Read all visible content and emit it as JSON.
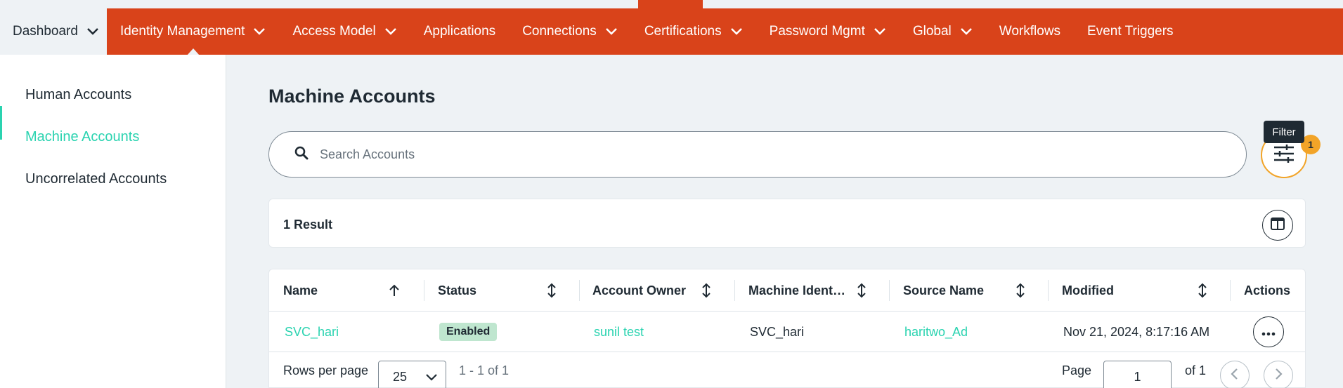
{
  "nav": {
    "items": [
      {
        "label": "Dashboard",
        "dropdown": true
      },
      {
        "label": "Identity Management",
        "dropdown": true,
        "active": true
      },
      {
        "label": "Access Model",
        "dropdown": true
      },
      {
        "label": "Applications",
        "dropdown": false
      },
      {
        "label": "Connections",
        "dropdown": true
      },
      {
        "label": "Certifications",
        "dropdown": true
      },
      {
        "label": "Password Mgmt",
        "dropdown": true
      },
      {
        "label": "Global",
        "dropdown": true
      },
      {
        "label": "Workflows",
        "dropdown": false
      },
      {
        "label": "Event Triggers",
        "dropdown": false
      }
    ],
    "bg_color": "#d9431a"
  },
  "sidebar": {
    "items": [
      {
        "label": "Human Accounts"
      },
      {
        "label": "Machine Accounts",
        "active": true
      },
      {
        "label": "Uncorrelated Accounts"
      }
    ],
    "accent_color": "#2ad3b0"
  },
  "main": {
    "title": "Machine Accounts",
    "search": {
      "placeholder": "Search Accounts",
      "value": "",
      "icon": "search-icon"
    },
    "filter": {
      "tooltip": "Filter",
      "badge_count": "1",
      "icon": "filter-sliders-icon"
    },
    "result_count": "1 Result",
    "table": {
      "columns": [
        "Name",
        "Status",
        "Account Owner",
        "Machine Ident…",
        "Source Name",
        "Modified",
        "Actions"
      ],
      "rows": [
        {
          "name": "SVC_hari",
          "status": "Enabled",
          "account_owner": "sunil test",
          "machine_identity": "SVC_hari",
          "source_name": "haritwo_Ad",
          "modified": "Nov 21, 2024, 8:17:16 AM"
        }
      ]
    },
    "pagination": {
      "rows_per_page_label": "Rows per page",
      "rows_per_page": "25",
      "range": "1 - 1 of 1",
      "page_label": "Page",
      "page": "1",
      "of_pages": "of 1"
    }
  }
}
